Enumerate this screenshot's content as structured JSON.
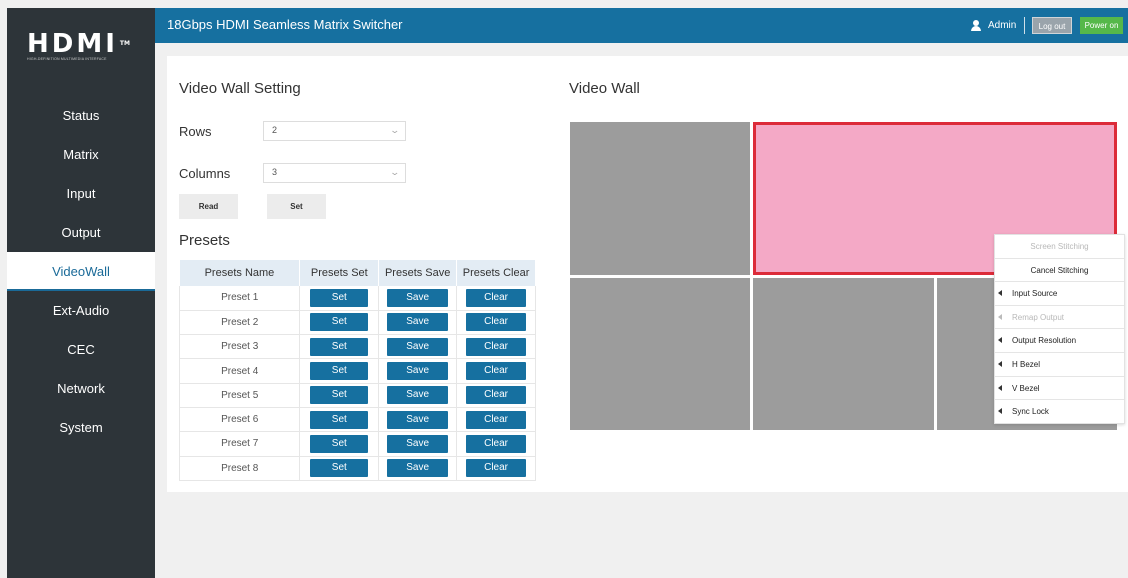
{
  "brand": {
    "logo_text": "HDMI",
    "logo_tm": "TM",
    "logo_tagline": "HIGH-DEFINITION MULTIMEDIA INTERFACE"
  },
  "header": {
    "title": "18Gbps HDMI Seamless Matrix Switcher",
    "user_icon": "user-icon",
    "user": "Admin",
    "logout_label": "Log out",
    "power_label": "Power on"
  },
  "colors": {
    "sidebar_bg": "#2d3439",
    "header_bg": "#1670a0",
    "accent": "#1670a0",
    "power_green": "#55b84a",
    "merged_fill": "#f4a9c6",
    "merged_border": "#dc2b39",
    "wall_cell": "#9c9c9c"
  },
  "sidebar": {
    "items": [
      {
        "label": "Status",
        "active": false
      },
      {
        "label": "Matrix",
        "active": false
      },
      {
        "label": "Input",
        "active": false
      },
      {
        "label": "Output",
        "active": false
      },
      {
        "label": "VideoWall",
        "active": true
      },
      {
        "label": "Ext-Audio",
        "active": false
      },
      {
        "label": "CEC",
        "active": false
      },
      {
        "label": "Network",
        "active": false
      },
      {
        "label": "System",
        "active": false
      }
    ]
  },
  "settings": {
    "title": "Video Wall Setting",
    "rows_label": "Rows",
    "rows_value": "2",
    "columns_label": "Columns",
    "columns_value": "3",
    "read_label": "Read",
    "set_label": "Set"
  },
  "presets": {
    "title": "Presets",
    "headers": [
      "Presets Name",
      "Presets Set",
      "Presets Save",
      "Presets Clear"
    ],
    "set_label": "Set",
    "save_label": "Save",
    "clear_label": "Clear",
    "rows": [
      "Preset 1",
      "Preset 2",
      "Preset 3",
      "Preset 4",
      "Preset 5",
      "Preset 6",
      "Preset 7",
      "Preset 8"
    ]
  },
  "videowall": {
    "title": "Video Wall",
    "rows": 2,
    "columns": 3,
    "merged": {
      "row": 1,
      "col_start": 2,
      "col_end": 3
    }
  },
  "context_menu": {
    "items": [
      {
        "label": "Screen Stitching",
        "disabled": true,
        "submenu": false
      },
      {
        "label": "Cancel Stitching",
        "disabled": false,
        "submenu": false
      },
      {
        "label": "Input Source",
        "disabled": false,
        "submenu": true
      },
      {
        "label": "Remap Output",
        "disabled": true,
        "submenu": true
      },
      {
        "label": "Output Resolution",
        "disabled": false,
        "submenu": true
      },
      {
        "label": "H Bezel",
        "disabled": false,
        "submenu": true
      },
      {
        "label": "V Bezel",
        "disabled": false,
        "submenu": true
      },
      {
        "label": "Sync Lock",
        "disabled": false,
        "submenu": true
      }
    ]
  }
}
